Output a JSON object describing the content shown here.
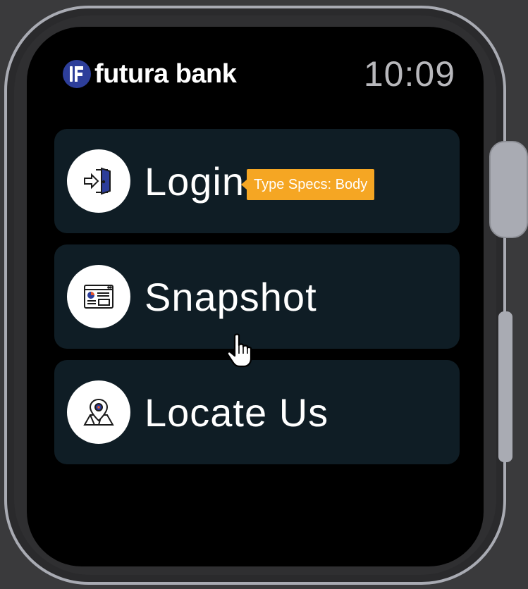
{
  "header": {
    "brand_name": "futura bank",
    "logo_icon": "futura-bank-logo-icon",
    "time": "10:09"
  },
  "menu": {
    "items": [
      {
        "label": "Login",
        "icon": "door-enter-icon"
      },
      {
        "label": "Snapshot",
        "icon": "dashboard-snapshot-icon"
      },
      {
        "label": "Locate Us",
        "icon": "map-pin-icon"
      }
    ]
  },
  "tooltip": {
    "text": "Type Specs: Body"
  },
  "colors": {
    "screen_bg": "#000000",
    "card_bg": "#0f1d25",
    "brand_blue": "#2d3e9a",
    "accent_orange": "#f5a623",
    "clock_gray": "#b8b8bc",
    "case_silver": "#a9abb3"
  }
}
